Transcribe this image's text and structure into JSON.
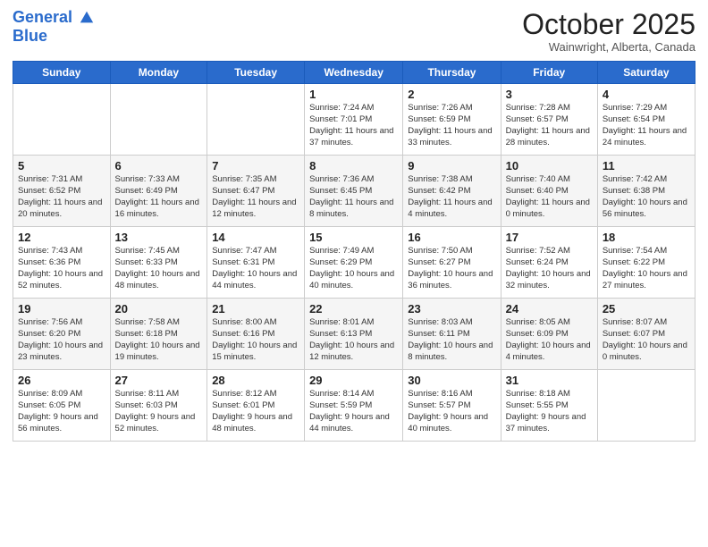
{
  "header": {
    "logo_line1": "General",
    "logo_line2": "Blue",
    "month": "October 2025",
    "location": "Wainwright, Alberta, Canada"
  },
  "weekdays": [
    "Sunday",
    "Monday",
    "Tuesday",
    "Wednesday",
    "Thursday",
    "Friday",
    "Saturday"
  ],
  "weeks": [
    [
      {
        "day": "",
        "info": ""
      },
      {
        "day": "",
        "info": ""
      },
      {
        "day": "",
        "info": ""
      },
      {
        "day": "1",
        "info": "Sunrise: 7:24 AM\nSunset: 7:01 PM\nDaylight: 11 hours\nand 37 minutes."
      },
      {
        "day": "2",
        "info": "Sunrise: 7:26 AM\nSunset: 6:59 PM\nDaylight: 11 hours\nand 33 minutes."
      },
      {
        "day": "3",
        "info": "Sunrise: 7:28 AM\nSunset: 6:57 PM\nDaylight: 11 hours\nand 28 minutes."
      },
      {
        "day": "4",
        "info": "Sunrise: 7:29 AM\nSunset: 6:54 PM\nDaylight: 11 hours\nand 24 minutes."
      }
    ],
    [
      {
        "day": "5",
        "info": "Sunrise: 7:31 AM\nSunset: 6:52 PM\nDaylight: 11 hours\nand 20 minutes."
      },
      {
        "day": "6",
        "info": "Sunrise: 7:33 AM\nSunset: 6:49 PM\nDaylight: 11 hours\nand 16 minutes."
      },
      {
        "day": "7",
        "info": "Sunrise: 7:35 AM\nSunset: 6:47 PM\nDaylight: 11 hours\nand 12 minutes."
      },
      {
        "day": "8",
        "info": "Sunrise: 7:36 AM\nSunset: 6:45 PM\nDaylight: 11 hours\nand 8 minutes."
      },
      {
        "day": "9",
        "info": "Sunrise: 7:38 AM\nSunset: 6:42 PM\nDaylight: 11 hours\nand 4 minutes."
      },
      {
        "day": "10",
        "info": "Sunrise: 7:40 AM\nSunset: 6:40 PM\nDaylight: 11 hours\nand 0 minutes."
      },
      {
        "day": "11",
        "info": "Sunrise: 7:42 AM\nSunset: 6:38 PM\nDaylight: 10 hours\nand 56 minutes."
      }
    ],
    [
      {
        "day": "12",
        "info": "Sunrise: 7:43 AM\nSunset: 6:36 PM\nDaylight: 10 hours\nand 52 minutes."
      },
      {
        "day": "13",
        "info": "Sunrise: 7:45 AM\nSunset: 6:33 PM\nDaylight: 10 hours\nand 48 minutes."
      },
      {
        "day": "14",
        "info": "Sunrise: 7:47 AM\nSunset: 6:31 PM\nDaylight: 10 hours\nand 44 minutes."
      },
      {
        "day": "15",
        "info": "Sunrise: 7:49 AM\nSunset: 6:29 PM\nDaylight: 10 hours\nand 40 minutes."
      },
      {
        "day": "16",
        "info": "Sunrise: 7:50 AM\nSunset: 6:27 PM\nDaylight: 10 hours\nand 36 minutes."
      },
      {
        "day": "17",
        "info": "Sunrise: 7:52 AM\nSunset: 6:24 PM\nDaylight: 10 hours\nand 32 minutes."
      },
      {
        "day": "18",
        "info": "Sunrise: 7:54 AM\nSunset: 6:22 PM\nDaylight: 10 hours\nand 27 minutes."
      }
    ],
    [
      {
        "day": "19",
        "info": "Sunrise: 7:56 AM\nSunset: 6:20 PM\nDaylight: 10 hours\nand 23 minutes."
      },
      {
        "day": "20",
        "info": "Sunrise: 7:58 AM\nSunset: 6:18 PM\nDaylight: 10 hours\nand 19 minutes."
      },
      {
        "day": "21",
        "info": "Sunrise: 8:00 AM\nSunset: 6:16 PM\nDaylight: 10 hours\nand 15 minutes."
      },
      {
        "day": "22",
        "info": "Sunrise: 8:01 AM\nSunset: 6:13 PM\nDaylight: 10 hours\nand 12 minutes."
      },
      {
        "day": "23",
        "info": "Sunrise: 8:03 AM\nSunset: 6:11 PM\nDaylight: 10 hours\nand 8 minutes."
      },
      {
        "day": "24",
        "info": "Sunrise: 8:05 AM\nSunset: 6:09 PM\nDaylight: 10 hours\nand 4 minutes."
      },
      {
        "day": "25",
        "info": "Sunrise: 8:07 AM\nSunset: 6:07 PM\nDaylight: 10 hours\nand 0 minutes."
      }
    ],
    [
      {
        "day": "26",
        "info": "Sunrise: 8:09 AM\nSunset: 6:05 PM\nDaylight: 9 hours\nand 56 minutes."
      },
      {
        "day": "27",
        "info": "Sunrise: 8:11 AM\nSunset: 6:03 PM\nDaylight: 9 hours\nand 52 minutes."
      },
      {
        "day": "28",
        "info": "Sunrise: 8:12 AM\nSunset: 6:01 PM\nDaylight: 9 hours\nand 48 minutes."
      },
      {
        "day": "29",
        "info": "Sunrise: 8:14 AM\nSunset: 5:59 PM\nDaylight: 9 hours\nand 44 minutes."
      },
      {
        "day": "30",
        "info": "Sunrise: 8:16 AM\nSunset: 5:57 PM\nDaylight: 9 hours\nand 40 minutes."
      },
      {
        "day": "31",
        "info": "Sunrise: 8:18 AM\nSunset: 5:55 PM\nDaylight: 9 hours\nand 37 minutes."
      },
      {
        "day": "",
        "info": ""
      }
    ]
  ]
}
